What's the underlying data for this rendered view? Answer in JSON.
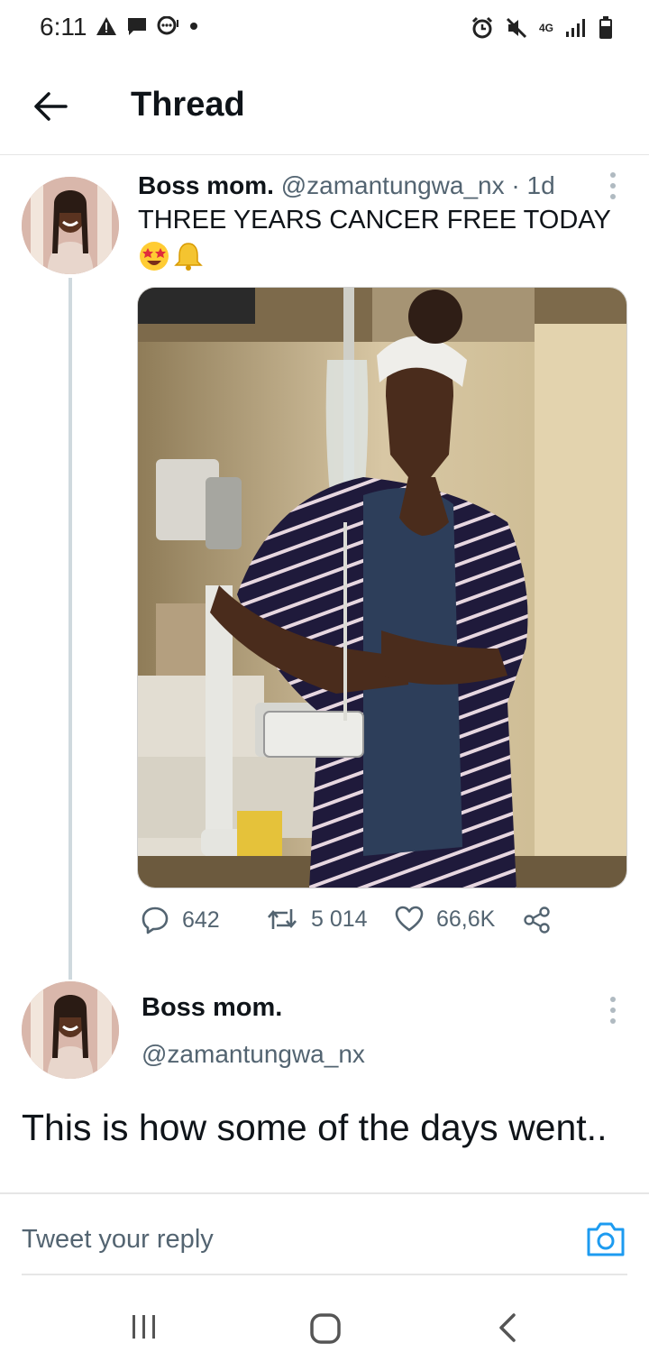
{
  "status_bar": {
    "time": "6:11",
    "network": "4G"
  },
  "header": {
    "title": "Thread"
  },
  "tweet1": {
    "name": "Boss mom.",
    "handle": "@zamantungwa_nx",
    "separator": "·",
    "age": "1d",
    "text": "THREE YEARS CANCER FREE TODAY",
    "emojis": [
      "star-struck-emoji",
      "bell-emoji"
    ],
    "media_description_icon": "photo-media",
    "replies": "642",
    "retweets": "5 014",
    "likes": "66,6K"
  },
  "tweet2": {
    "name": "Boss mom.",
    "handle": "@zamantungwa_nx",
    "text": "This is how some of the days went.."
  },
  "reply": {
    "placeholder": "Tweet your reply"
  },
  "colors": {
    "accent": "#1d9bf0",
    "text_primary": "#0f1419",
    "text_secondary": "#536471",
    "thread_line": "#cfd9de"
  }
}
